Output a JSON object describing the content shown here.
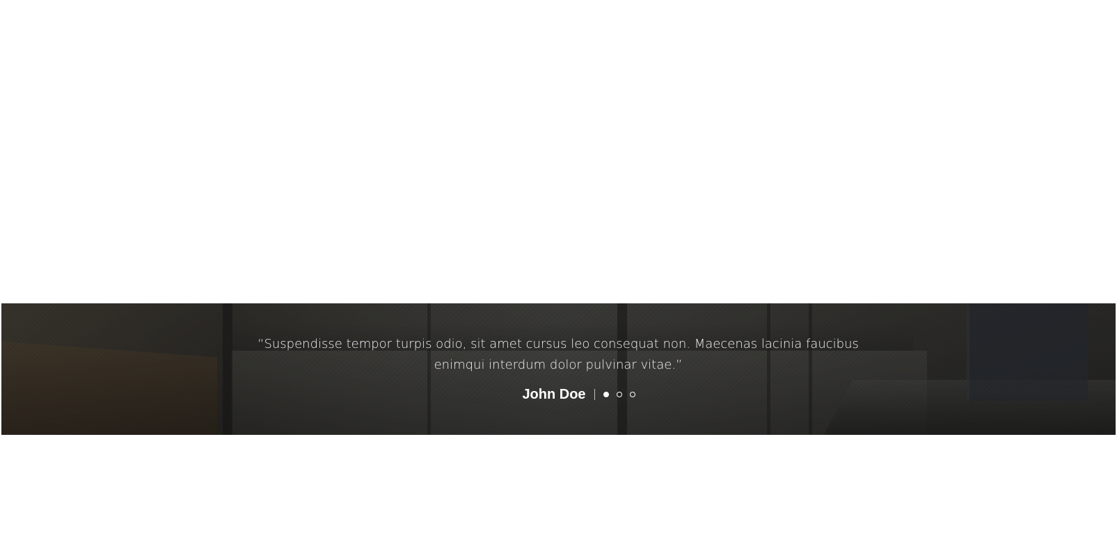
{
  "testimonial": {
    "quote": "“Suspendisse tempor turpis odio, sit amet cursus leo consequat non. Maecenas lacinia faucibus enimqui interdum dolor pulvinar vitae.”",
    "author": "John Doe",
    "slides": [
      {
        "active": true
      },
      {
        "active": false
      },
      {
        "active": false
      }
    ]
  },
  "colors": {
    "text": "#ffffff",
    "page_background": "#ffffff"
  }
}
